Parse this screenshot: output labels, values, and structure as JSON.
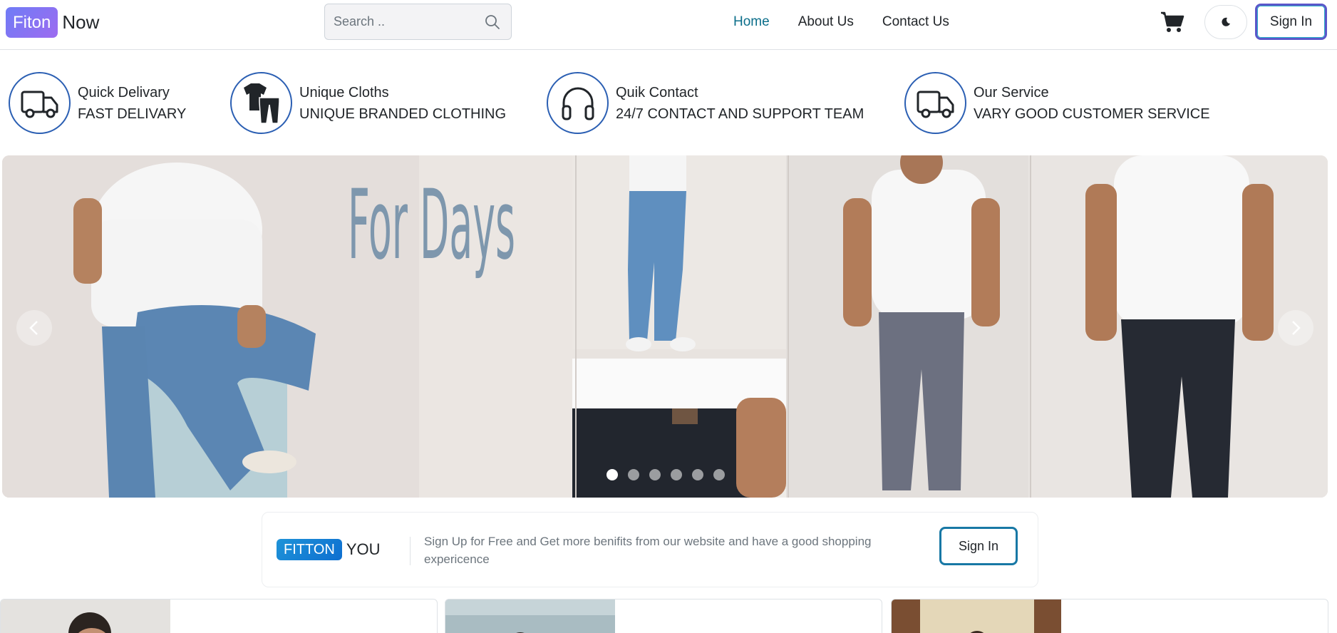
{
  "header": {
    "logo_badge": "Fiton",
    "logo_text": "Now",
    "search_placeholder": "Search ..",
    "nav": [
      {
        "label": "Home",
        "active": true
      },
      {
        "label": "About Us",
        "active": false
      },
      {
        "label": "Contact Us",
        "active": false
      }
    ],
    "signin_label": "Sign In",
    "icons": {
      "search": "search-icon",
      "cart": "cart-icon",
      "theme": "moon-icon"
    }
  },
  "features": [
    {
      "title": "Quick Delivary",
      "subtitle": "FAST DELIVARY",
      "icon": "truck-icon"
    },
    {
      "title": "Unique Cloths",
      "subtitle": "UNIQUE BRANDED CLOTHING",
      "icon": "clothes-icon"
    },
    {
      "title": "Quik Contact",
      "subtitle": "24/7 CONTACT AND SUPPORT TEAM",
      "icon": "headphones-icon"
    },
    {
      "title": "Our Service",
      "subtitle": "VARY GOOD CUSTOMER SERVICE",
      "icon": "truck-icon"
    }
  ],
  "carousel": {
    "slide_text": "For Days",
    "slide_count": 6,
    "active_index": 0
  },
  "promo": {
    "brand_badge": "FITTON",
    "brand_text": "YOU",
    "message": "Sign Up for Free and Get more benifits from our website and have a good shopping expericence",
    "signin_label": "Sign In"
  },
  "colors": {
    "accent": "#0b6e8a",
    "logo_gradient_start": "#6f7cf6",
    "logo_gradient_end": "#9d6bf0",
    "feature_ring": "#2b5fb3",
    "promo_badge": "#1e93d8"
  }
}
